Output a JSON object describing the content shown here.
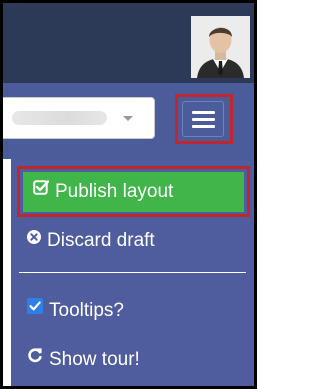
{
  "menu": {
    "items": [
      {
        "label": "Publish layout",
        "icon": "check-square-icon",
        "highlighted": true
      },
      {
        "label": "Discard draft",
        "icon": "times-circle-icon"
      },
      {
        "label": "Tooltips?",
        "icon": "checkbox-checked-icon",
        "checked": true
      },
      {
        "label": "Show tour!",
        "icon": "refresh-icon"
      }
    ]
  },
  "colors": {
    "topbar": "#2c3a57",
    "navbar": "#4a5d9a",
    "dropdown": "#4f5c9d",
    "publish": "#3fb54a",
    "highlight_outline": "#c0272d",
    "checkbox": "#2f7fe8"
  }
}
